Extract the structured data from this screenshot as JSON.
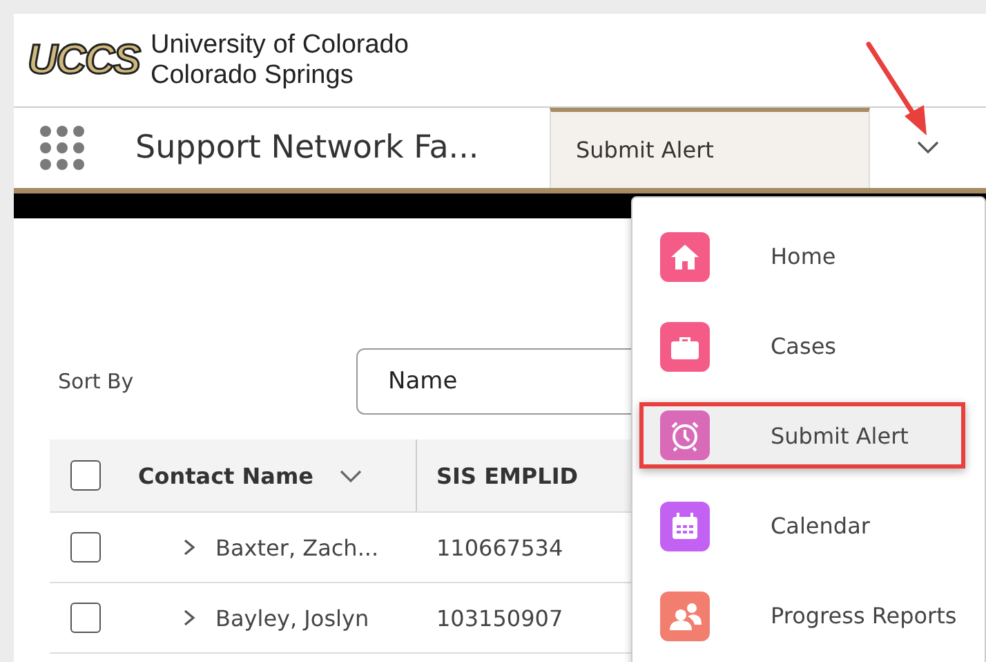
{
  "header": {
    "logo": "UCCS",
    "university": [
      "University of Colorado",
      "Colorado Springs"
    ]
  },
  "nav": {
    "app_name": "Support Network Fa...",
    "tabs": [
      {
        "label": "Submit Alert",
        "selected": true
      }
    ]
  },
  "sort": {
    "label": "Sort By",
    "value": "Name"
  },
  "table": {
    "all_checked": false,
    "columns": [
      {
        "label": "Contact Name",
        "sortable": true
      },
      {
        "label": "SIS EMPLID",
        "sortable": false
      }
    ],
    "rows": [
      {
        "name": "Baxter, Zach...",
        "emplid": "110667534",
        "checked": false
      },
      {
        "name": "Bayley, Joslyn",
        "emplid": "103150907",
        "checked": false
      }
    ]
  },
  "menu": {
    "items": [
      {
        "label": "Home",
        "kind": "home",
        "color": "#f45c87",
        "selected": false
      },
      {
        "label": "Cases",
        "kind": "briefcase",
        "color": "#f45c87",
        "selected": false
      },
      {
        "label": "Submit Alert",
        "kind": "alarm",
        "color": "#d86ab8",
        "selected": true
      },
      {
        "label": "Calendar",
        "kind": "calendar",
        "color": "#c261f2",
        "selected": false
      },
      {
        "label": "Progress Reports",
        "kind": "people",
        "color": "#f27e70",
        "selected": false
      }
    ]
  }
}
